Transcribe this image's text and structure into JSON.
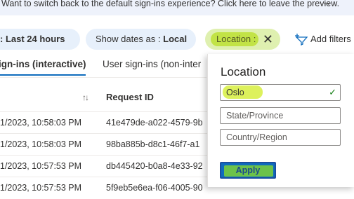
{
  "banner": {
    "text": "Want to switch back to the default sign-ins experience? Click here to leave the preview.",
    "arrow_icon": "arrow-right-icon"
  },
  "filters": {
    "range": {
      "label": ": Last 24 hours"
    },
    "dates": {
      "label": "Show dates as : ",
      "value": "Local"
    },
    "location": {
      "label": "Location :",
      "close_icon": "close-icon"
    },
    "add_filters": {
      "label": "Add filters",
      "icon": "add-filter-icon"
    }
  },
  "tabs": [
    {
      "label": "ign-ins (interactive)",
      "selected": true
    },
    {
      "label": "User sign-ins (non-inter",
      "selected": false
    }
  ],
  "table": {
    "columns": {
      "sort_icon": "↑↓",
      "request_id": "Request ID"
    },
    "rows": [
      {
        "date": "1/2023, 10:58:03 PM",
        "request_id": "41e479de-a022-4579-9b"
      },
      {
        "date": "1/2023, 10:58:03 PM",
        "request_id": "98ba885b-d8c1-46f7-a1"
      },
      {
        "date": "1/2023, 10:57:53 PM",
        "request_id": "db445420-b0a8-4e33-92"
      },
      {
        "date": "1/2023, 10:57:53 PM",
        "request_id": "5f9eb5e6ea-f06-4005-90"
      }
    ]
  },
  "location_panel": {
    "title": "Location",
    "city": {
      "value": "Oslo",
      "valid": true
    },
    "state": {
      "placeholder": "State/Province"
    },
    "country": {
      "placeholder": "Country/Region"
    },
    "apply_label": "Apply"
  },
  "colors": {
    "accent": "#0f6cbd",
    "highlight": "#d9f04a",
    "success": "#107c10"
  }
}
